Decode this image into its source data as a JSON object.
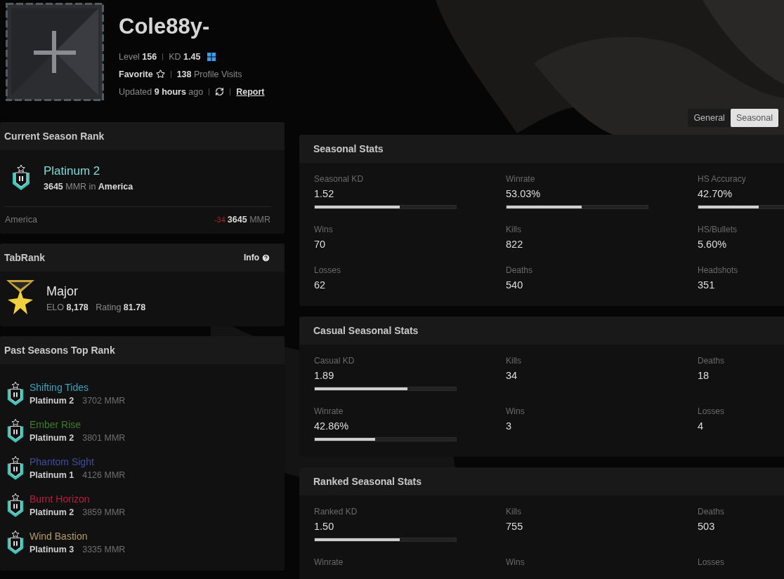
{
  "profile": {
    "name": "Cole88y-",
    "level": "Level **156**",
    "kd": "KD **1.45**",
    "favorite": "Favorite",
    "favorited": false,
    "visits": "**138** Profile Visits",
    "updated": "Updated **9 hours** ago",
    "report": "Report"
  },
  "current_season": {
    "title": "Current Season Rank",
    "rank": "Platinum 2",
    "detail": "**3645** MMR in **America**",
    "region": "America",
    "change": "-34",
    "mmr": "**3645** MMR"
  },
  "tabrank": {
    "title": "TabRank",
    "info": "Info",
    "rank": "Major",
    "detail": "ELO **8,178**   Rating **81.78**"
  },
  "past_seasons": {
    "title": "Past Seasons Top Rank",
    "items": [
      {
        "season": "Shifting Tides",
        "color": "#3aa3bd",
        "rank": "Platinum 2",
        "mmr": "3702 MMR"
      },
      {
        "season": "Ember Rise",
        "color": "#3f7d2b",
        "rank": "Platinum 2",
        "mmr": "3801 MMR"
      },
      {
        "season": "Phantom Sight",
        "color": "#434d9e",
        "rank": "Platinum 1",
        "mmr": "4126 MMR"
      },
      {
        "season": "Burnt Horizon",
        "color": "#c4173f",
        "rank": "Platinum 2",
        "mmr": "3859 MMR"
      },
      {
        "season": "Wind Bastion",
        "color": "#b39c6c",
        "rank": "Platinum 3",
        "mmr": "3335 MMR"
      }
    ]
  },
  "tabs": [
    {
      "label": "General",
      "selected": false
    },
    {
      "label": "Seasonal",
      "selected": true
    }
  ],
  "sections": [
    {
      "title": "Seasonal Stats",
      "stats": [
        {
          "label": "Seasonal KD",
          "value": "1.52",
          "level": 0.6
        },
        {
          "label": "Winrate",
          "value": "53.03%",
          "level": 0.53
        },
        {
          "label": "HS Accuracy",
          "value": "42.70%",
          "level": 0.427
        },
        {
          "label": "Wins",
          "value": "70"
        },
        {
          "label": "Kills",
          "value": "822"
        },
        {
          "label": "HS/Bullets",
          "value": "5.60%"
        },
        {
          "label": "Losses",
          "value": "62"
        },
        {
          "label": "Deaths",
          "value": "540"
        },
        {
          "label": "Headshots",
          "value": "351"
        }
      ]
    },
    {
      "title": "Casual Seasonal Stats",
      "stats": [
        {
          "label": "Casual KD",
          "value": "1.89",
          "level": 0.655
        },
        {
          "label": "Kills",
          "value": "34"
        },
        {
          "label": "Deaths",
          "value": "18"
        },
        {
          "label": "Winrate",
          "value": "42.86%",
          "level": 0.4286
        },
        {
          "label": "Wins",
          "value": "3"
        },
        {
          "label": "Losses",
          "value": "4"
        }
      ]
    },
    {
      "title": "Ranked Seasonal Stats",
      "stats": [
        {
          "label": "Ranked KD",
          "value": "1.50",
          "level": 0.6
        },
        {
          "label": "Kills",
          "value": "755"
        },
        {
          "label": "Deaths",
          "value": "503"
        },
        {
          "label": "Winrate"
        },
        {
          "label": "Wins"
        },
        {
          "label": "Losses"
        }
      ]
    }
  ]
}
